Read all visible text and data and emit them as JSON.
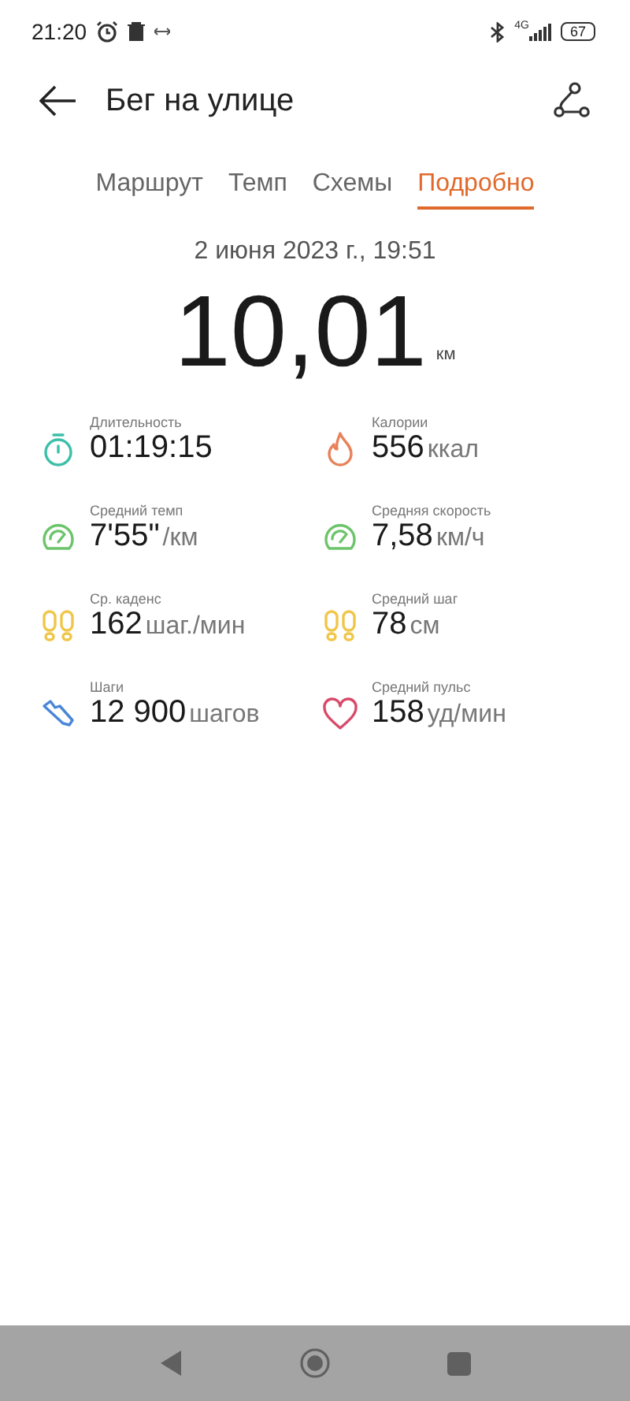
{
  "status_bar": {
    "time": "21:20",
    "network": "4G",
    "battery": "67"
  },
  "header": {
    "title": "Бег на улице"
  },
  "tabs": [
    {
      "label": "Маршрут",
      "selected": false
    },
    {
      "label": "Темп",
      "selected": false
    },
    {
      "label": "Схемы",
      "selected": false
    },
    {
      "label": "Подробно",
      "selected": true
    }
  ],
  "date": "2 июня 2023 г., 19:51",
  "distance": {
    "value": "10,01",
    "unit": "км"
  },
  "stats": [
    {
      "kind": "stopwatch",
      "color": "#3dbfa8",
      "label": "Длительность",
      "value": "01:19:15"
    },
    {
      "kind": "flame",
      "color": "#e8825a",
      "label": "Калории",
      "value": "556",
      "unit": "ккал"
    },
    {
      "kind": "gauge",
      "color": "#6cc46a",
      "label": "Средний темп",
      "value": "7'55\"",
      "unit": "/км"
    },
    {
      "kind": "gauge",
      "color": "#6cc46a",
      "label": "Средняя скорость",
      "value": "7,58",
      "unit": "км/ч"
    },
    {
      "kind": "feet",
      "color": "#f0c64a",
      "label": "Ср. каденс",
      "value": "162",
      "unit": "шаг./мин"
    },
    {
      "kind": "feet",
      "color": "#f0c64a",
      "label": "Средний шаг",
      "value": "78",
      "unit": "см"
    },
    {
      "kind": "shoe",
      "color": "#4a86d8",
      "label": "Шаги",
      "value": "12 900",
      "unit": "шагов"
    },
    {
      "kind": "heart",
      "color": "#d94a6a",
      "label": "Средний пульс",
      "value": "158",
      "unit": "уд/мин"
    }
  ]
}
